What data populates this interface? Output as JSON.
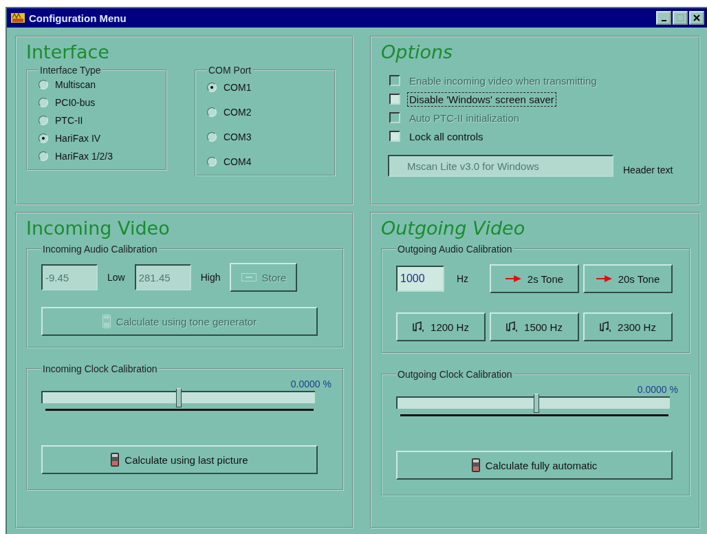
{
  "window": {
    "title": "Configuration Menu"
  },
  "interface": {
    "title": "Interface",
    "interface_type": {
      "label": "Interface Type",
      "options": [
        {
          "label": "Multiscan",
          "selected": false
        },
        {
          "label": "PCI0-bus",
          "selected": false
        },
        {
          "label": "PTC-II",
          "selected": false
        },
        {
          "label": "HariFax IV",
          "selected": true
        },
        {
          "label": "HariFax 1/2/3",
          "selected": false
        }
      ]
    },
    "com_port": {
      "label": "COM Port",
      "options": [
        {
          "label": "COM1",
          "selected": true
        },
        {
          "label": "COM2",
          "selected": false
        },
        {
          "label": "COM3",
          "selected": false
        },
        {
          "label": "COM4",
          "selected": false
        }
      ]
    }
  },
  "options": {
    "title": "Options",
    "checkboxes": [
      {
        "label": "Enable incoming video when transmitting",
        "checked": false,
        "disabled": true,
        "focused": false
      },
      {
        "label": "Disable 'Windows' screen saver",
        "checked": false,
        "disabled": false,
        "focused": true
      },
      {
        "label": "Auto PTC-II initialization",
        "checked": false,
        "disabled": true,
        "focused": false
      },
      {
        "label": "Lock all controls",
        "checked": false,
        "disabled": false,
        "focused": false
      }
    ],
    "header_field": {
      "value": "Mscan Lite v3.0 for Windows",
      "disabled": true
    },
    "header_label": "Header text"
  },
  "incoming_video": {
    "title": "Incoming Video",
    "audio_calibration": {
      "label": "Incoming Audio Calibration",
      "low_field": {
        "value": "-9.45",
        "disabled": true
      },
      "low_label": "Low",
      "high_field": {
        "value": "281.45",
        "disabled": true
      },
      "high_label": "High",
      "store_button": {
        "label": "Store",
        "disabled": true
      },
      "calculate_button": {
        "label": "Calculate using tone generator",
        "disabled": true
      }
    },
    "clock_calibration": {
      "label": "Incoming Clock Calibration",
      "reading": "0.0000 %",
      "level": 0.5,
      "calculate_button": {
        "label": "Calculate using last picture",
        "disabled": false
      }
    }
  },
  "outgoing_video": {
    "title": "Outgoing Video",
    "audio_calibration": {
      "label": "Outgoing Audio Calibration",
      "frequency_field": {
        "value": "1000"
      },
      "unit": "Hz",
      "tone_buttons": [
        {
          "label": "2s Tone"
        },
        {
          "label": "20s Tone"
        }
      ],
      "frequency_buttons": [
        {
          "label": "1200 Hz"
        },
        {
          "label": "1500 Hz"
        },
        {
          "label": "2300 Hz"
        }
      ]
    },
    "clock_calibration": {
      "label": "Outgoing Clock Calibration",
      "reading": "0.0000 %",
      "level": 0.51,
      "calculate_button": {
        "label": "Calculate fully automatic",
        "disabled": false
      }
    }
  }
}
